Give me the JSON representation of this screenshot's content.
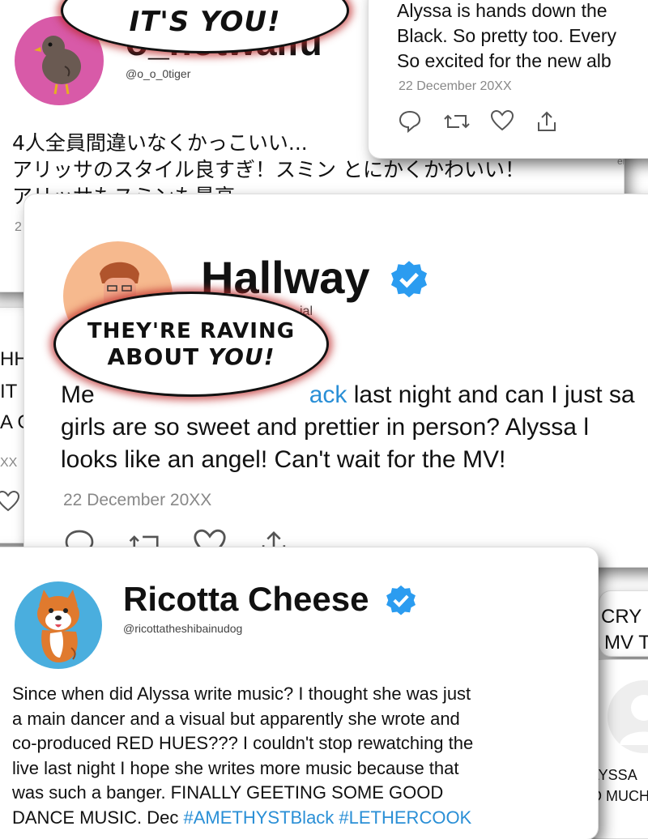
{
  "tweet_tiger": {
    "name": "o_notwaifu",
    "handle": "@o_o_0tiger",
    "body_lines": [
      "4人全員間違いなくかっこいい...",
      "アリッサのスタイル良すぎ！スミン とにかくかわいい！",
      "アリッサもスミンも最高"
    ],
    "date_fragment": "2"
  },
  "tweet_top_right": {
    "body_lines": [
      "Alyssa is hands down the",
      "Black. So pretty too. Every",
      "So excited for the new alb"
    ],
    "date": "22 December 20XX",
    "date_fragment": "ember"
  },
  "tweet_hallway": {
    "name": "Hallway",
    "handle_fragment": "ial",
    "body_line1_prefix": "Me",
    "body_line1_link": "ack",
    "body_line1_suffix": "last night and can I just sa",
    "body_line2": "girls are so sweet and prettier in person? Alyssa l",
    "body_line3": "looks like an angel! Can't wait for the MV!",
    "date": "22 December 20XX"
  },
  "tweet_ricotta": {
    "name": "Ricotta Cheese",
    "handle": "@ricottatheshibainudog",
    "body_lines": [
      "Since when did Alyssa write music? I thought she was just",
      "a main dancer and a visual but apparently she wrote and",
      "co-produced RED HUES??? I couldn't stop rewatching the",
      "live last night I hope she writes more music because that",
      "was such a banger. FINALLY GEETING SOME GOOD"
    ],
    "body_last_prefix": "DANCE MUSIC. Dec",
    "body_last_link": "#AMETHYSTBlack #LETHERCOOK"
  },
  "left_edge_fragments": [
    "HH",
    "IT",
    "A G",
    "XX"
  ],
  "right_edge_fragments": [
    "CRY",
    "MV T",
    "LYSSA",
    "D MUCH"
  ],
  "bubble_top": {
    "line": "IT'S YOU!"
  },
  "bubble_main": {
    "line1": "THEY'RE RAVING",
    "line2_prefix": "ABOUT",
    "line2_emph": "YOU!"
  },
  "colors": {
    "verified": "#2b9cf0",
    "link": "#2a8fd6",
    "bubble_glow": "#be2828",
    "tiger_avatar": "#d85aa8",
    "shiba_avatar": "#4aaede",
    "hallway_avatar": "#f6b98e"
  }
}
